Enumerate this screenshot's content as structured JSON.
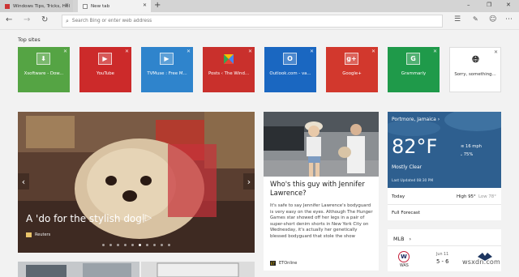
{
  "tabs": [
    {
      "title": "Windows Tips, Tricks, Hel"
    },
    {
      "title": "New tab"
    }
  ],
  "address": {
    "placeholder": "Search Bing or enter web address"
  },
  "top_sites": {
    "label": "Top sites",
    "tiles": [
      {
        "label": "Xsoftware - Dow...",
        "color": "#55a444",
        "icon": "download-icon"
      },
      {
        "label": "YouTube",
        "color": "#cc2a2a",
        "icon": "play-icon"
      },
      {
        "label": "TVMuse : Free M...",
        "color": "#2f84cc",
        "icon": "play-icon"
      },
      {
        "label": "Posts ‹ The Wind...",
        "color": "#c9302c",
        "icon": "windows-logo-icon"
      },
      {
        "label": "Outlook.com - va...",
        "color": "#1a67c1",
        "icon": "outlook-icon",
        "glyph": "O"
      },
      {
        "label": "Google+",
        "color": "#d2382d",
        "icon": "google-plus-icon",
        "glyph": "g+"
      },
      {
        "label": "Grammarly",
        "color": "#1f9a4a",
        "icon": "grammarly-icon",
        "glyph": "G"
      },
      {
        "label": "Sorry, something...",
        "color": "#ffffff",
        "icon": "globe-icon"
      }
    ]
  },
  "hero": {
    "title": "A 'do for the stylish dog",
    "source": "Reuters",
    "slide_count": 10,
    "active_slide": 5
  },
  "article": {
    "title": "Who's this guy with Jennifer Lawrence?",
    "body": "It's safe to say Jennifer Lawrence's bodyguard is very easy on the eyes. Although The Hunger Games star showed off her legs in a pair of super-short denim shorts in New York City on Wednesday, it's actually her genetically blessed bodyguard that stole the show",
    "source": "ETOnline"
  },
  "weather": {
    "location": "Portmore, Jamaica",
    "temp": "82°F",
    "wind": "16 mph",
    "humidity": "75%",
    "condition": "Mostly Clear",
    "updated": "Last Updated 08:30 PM",
    "today_label": "Today",
    "high": "High 95°",
    "low": "Low 78°",
    "full_forecast": "Full Forecast"
  },
  "mlb": {
    "title": "MLB",
    "team1": "WAS",
    "date": "Jun 11",
    "score": "5 - 6"
  },
  "watermark": "wsxdn.com",
  "colors": {
    "weather_bg": "#2e5f8f",
    "page_bg": "#f2f2f2"
  }
}
